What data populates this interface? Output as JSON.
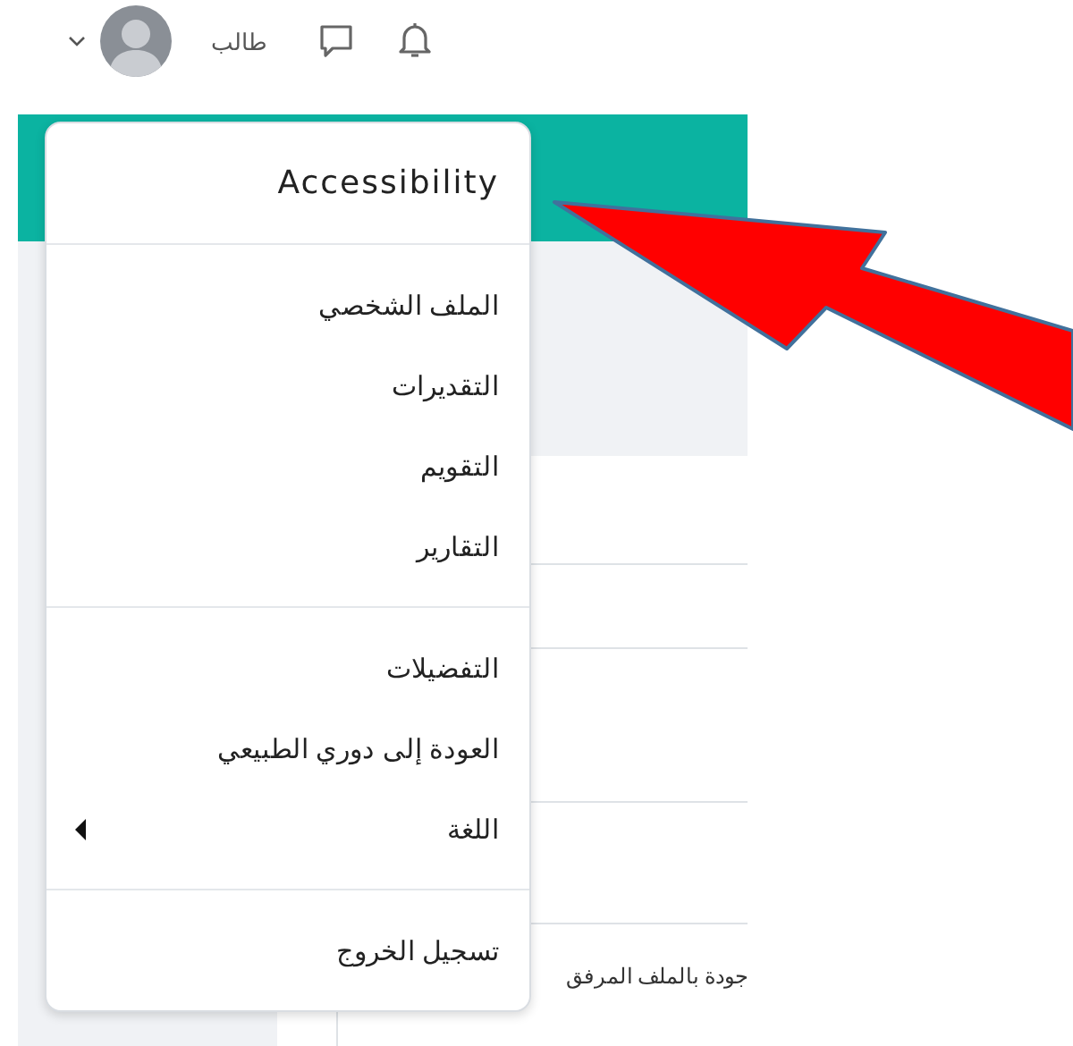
{
  "header": {
    "user_name": "طالب"
  },
  "user_menu": {
    "groups": [
      [
        {
          "label": "Accessibility",
          "kind": "heading"
        }
      ],
      [
        {
          "label": "الملف الشخصي",
          "kind": "item"
        },
        {
          "label": "التقديرات",
          "kind": "item"
        },
        {
          "label": "التقويم",
          "kind": "item"
        },
        {
          "label": "التقارير",
          "kind": "item"
        }
      ],
      [
        {
          "label": "التفضيلات",
          "kind": "item"
        },
        {
          "label": "العودة إلى دوري الطبيعي",
          "kind": "item"
        },
        {
          "label": "اللغة",
          "kind": "submenu"
        }
      ],
      [
        {
          "label": "تسجيل الخروج",
          "kind": "item"
        }
      ]
    ]
  },
  "page": {
    "text_fragment": "جودة بالملف المرفق"
  }
}
